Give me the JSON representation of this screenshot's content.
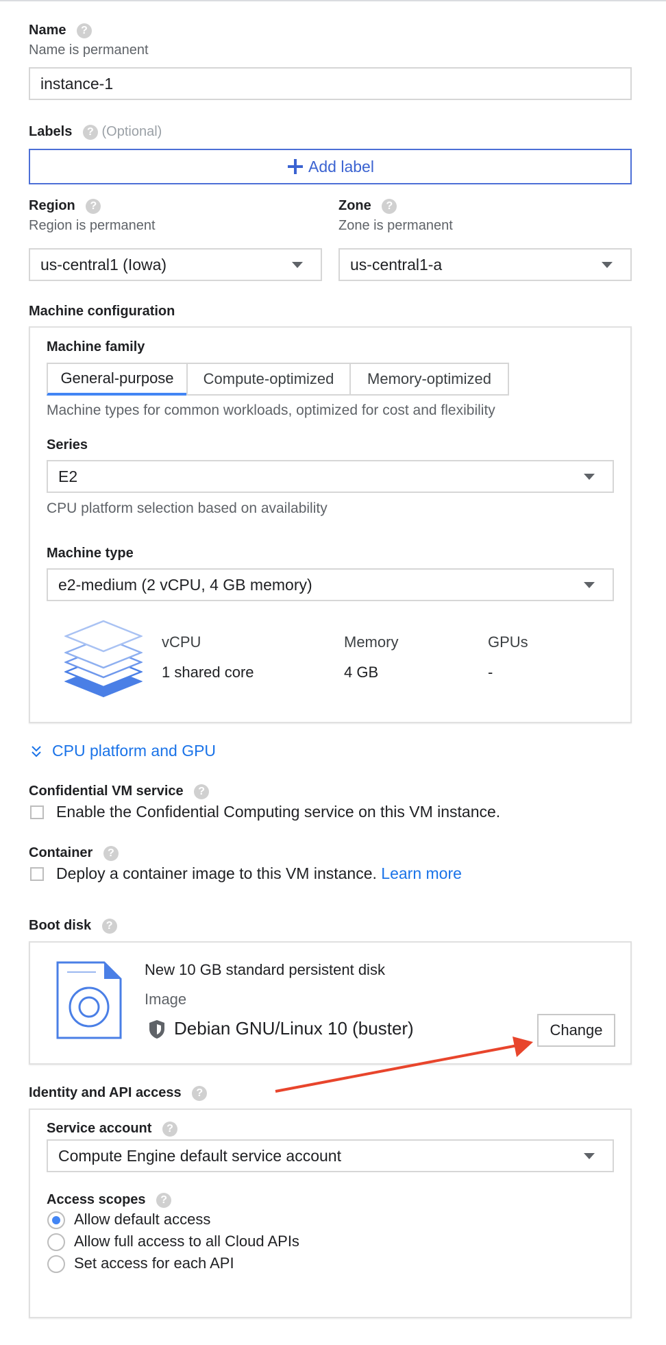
{
  "name": {
    "label": "Name",
    "sub": "Name is permanent",
    "value": "instance-1"
  },
  "labels": {
    "label": "Labels",
    "optional": "(Optional)",
    "add_label": "Add label"
  },
  "region": {
    "label": "Region",
    "sub": "Region is permanent",
    "value": "us-central1 (Iowa)"
  },
  "zone": {
    "label": "Zone",
    "sub": "Zone is permanent",
    "value": "us-central1-a"
  },
  "machine": {
    "title": "Machine configuration",
    "family_label": "Machine family",
    "tabs": [
      "General-purpose",
      "Compute-optimized",
      "Memory-optimized"
    ],
    "active_tab": "General-purpose",
    "family_desc": "Machine types for common workloads, optimized for cost and flexibility",
    "series_label": "Series",
    "series_value": "E2",
    "series_desc": "CPU platform selection based on availability",
    "type_label": "Machine type",
    "type_value": "e2-medium (2 vCPU, 4 GB memory)",
    "specs": {
      "vcpu_label": "vCPU",
      "vcpu_value": "1 shared core",
      "memory_label": "Memory",
      "memory_value": "4 GB",
      "gpus_label": "GPUs",
      "gpus_value": "-"
    }
  },
  "cpu_platform_link": "CPU platform and GPU",
  "confidential": {
    "label": "Confidential VM service",
    "checkbox": "Enable the Confidential Computing service on this VM instance."
  },
  "container": {
    "label": "Container",
    "checkbox": "Deploy a container image to this VM instance.",
    "learn_more": "Learn more"
  },
  "boot_disk": {
    "label": "Boot disk",
    "title": "New 10 GB standard persistent disk",
    "image_label": "Image",
    "image_value": "Debian GNU/Linux 10 (buster)",
    "change": "Change"
  },
  "identity": {
    "label": "Identity and API access",
    "service_account_label": "Service account",
    "service_account_value": "Compute Engine default service account",
    "scopes_label": "Access scopes",
    "scopes": [
      "Allow default access",
      "Allow full access to all Cloud APIs",
      "Set access for each API"
    ],
    "selected_scope": "Allow default access"
  },
  "help_glyph": "?",
  "colors": {
    "accent": "#4285f4",
    "link": "#1a73e8",
    "arrow": "#e8452c",
    "icon": "#4a7fe6"
  }
}
